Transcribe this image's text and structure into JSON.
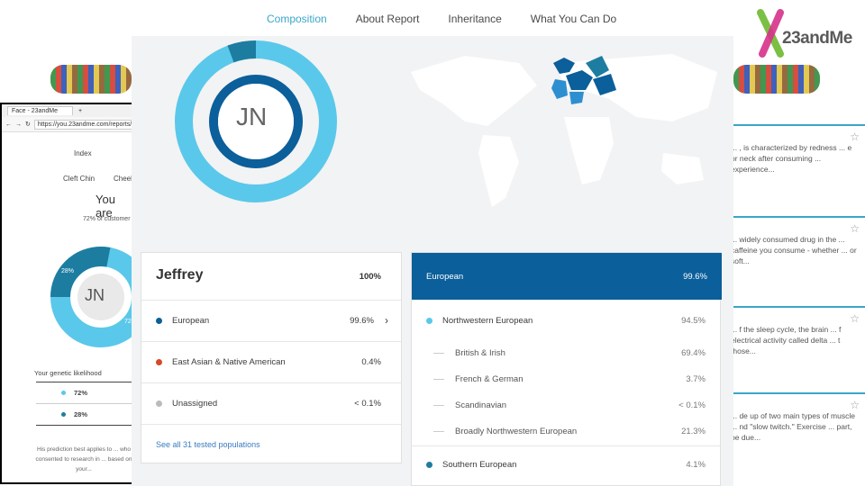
{
  "nav": {
    "items": [
      {
        "label": "Composition",
        "active": true
      },
      {
        "label": "About Report",
        "active": false
      },
      {
        "label": "Inheritance",
        "active": false
      },
      {
        "label": "What You Can Do",
        "active": false
      }
    ]
  },
  "logo": {
    "text": "23andMe"
  },
  "right_cards": [
    {
      "text": "... , is characterized by redness ... e or neck after consuming ... experience..."
    },
    {
      "text": "... widely consumed drug in the ... caffeine you consume - whether ... or soft..."
    },
    {
      "text": "... f the sleep cycle, the brain ... f electrical activity called delta ... t those..."
    },
    {
      "text": "... de up of two main types of muscle ... nd \"slow twitch.\" Exercise ... part, be due..."
    }
  ],
  "browser": {
    "tab_label": "Face - 23andMe",
    "url": "https://you.23andme.com/reports/traits/",
    "nav_index": "Index",
    "links": [
      "Cleft Chin",
      "Cheek"
    ],
    "heading": "You are",
    "sub": "72% of customer",
    "initials": "JN",
    "pct_outer": "28%",
    "pct_inner": "72",
    "likelihood_title": "Your genetic likelihood",
    "likelihood": [
      {
        "pct": "72%",
        "color": "#5ac8ea"
      },
      {
        "pct": "28%",
        "color": "#1d7da1"
      }
    ],
    "footnote": "His prediction best applies to ... who consented to research in ... based on your..."
  },
  "composition": {
    "initials": "JN",
    "name": "Jeffrey",
    "total": "100%",
    "rows": [
      {
        "label": "European",
        "pct": "99.6%",
        "color": "#0b5f9a",
        "chevron": "›"
      },
      {
        "label": "East Asian & Native American",
        "pct": "0.4%",
        "color": "#d44a2a",
        "chevron": ""
      },
      {
        "label": "Unassigned",
        "pct": "< 0.1%",
        "color": "#bbbbbb",
        "chevron": ""
      }
    ],
    "see_all": "See all 31 tested populations"
  },
  "european": {
    "header": "European",
    "header_pct": "99.6%",
    "items": [
      {
        "label": "Northwestern European",
        "pct": "94.5%",
        "level": 0,
        "color": "#5ac8ea"
      },
      {
        "label": "British & Irish",
        "pct": "69.4%",
        "level": 1
      },
      {
        "label": "French & German",
        "pct": "3.7%",
        "level": 1
      },
      {
        "label": "Scandinavian",
        "pct": "< 0.1%",
        "level": 1
      },
      {
        "label": "Broadly Northwestern European",
        "pct": "21.3%",
        "level": 1
      },
      {
        "label": "Southern European",
        "pct": "4.1%",
        "level": 0,
        "color": "#1d7da1"
      }
    ]
  },
  "colors": {
    "accent": "#3aa6c8",
    "euro_dark": "#0b5f9a",
    "light_blue": "#5ac8ea"
  }
}
